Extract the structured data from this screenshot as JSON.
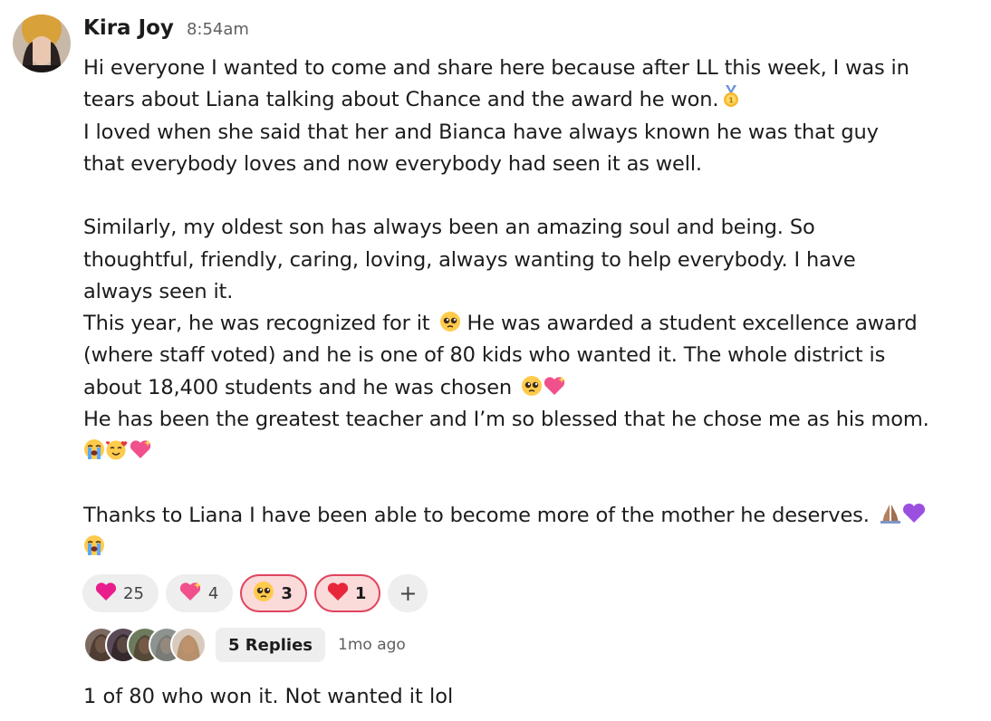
{
  "message": {
    "author": "Kira Joy",
    "time": "8:54am",
    "lines": [
      "Hi everyone I wanted to come and share here because after LL this week, I was in",
      "tears about Liana talking about Chance and the award he won.",
      "I loved when she said that her and Bianca have always known he was that guy",
      "that everybody loves and now everybody had seen it as well.",
      "",
      "Similarly, my oldest son has always been an amazing soul and being. So",
      "thoughtful, friendly, caring, loving, always wanting to help everybody. I have",
      "always seen it.",
      "This year, he was recognized for it",
      "He was awarded a student excellence award",
      "(where staff voted) and he is one of 80 kids who wanted it. The whole district is",
      "about 18,400 students and he was chosen",
      "He has been the greatest teacher and I’m so blessed that he chose me as his mom.",
      "",
      "",
      "Thanks to Liana I have been able to become more of the mother he deserves."
    ],
    "emoji": {
      "medal": "medal-emoji",
      "pleading": "pleading-face-emoji",
      "sparkling_heart": "sparkling-heart-emoji",
      "crying": "loudly-crying-face-emoji",
      "smiling_hearts": "smiling-face-with-hearts-emoji",
      "pray": "folded-hands-emoji",
      "purple_heart": "purple-heart-emoji"
    }
  },
  "reactions": [
    {
      "icon": "heart-pink-emoji",
      "count": "25",
      "active": false
    },
    {
      "icon": "sparkling-heart-emoji",
      "count": "4",
      "active": false
    },
    {
      "icon": "pleading-face-emoji",
      "count": "3",
      "active": true
    },
    {
      "icon": "red-heart-emoji",
      "count": "1",
      "active": true
    }
  ],
  "add_reaction_label": "+",
  "thread": {
    "replies_label": "5 Replies",
    "last_reply": "1mo ago"
  },
  "reply_preview": "1 of 80 who won it. Not wanted it lol",
  "colors": {
    "text": "#1d1c1d",
    "muted": "#616061",
    "pill_bg": "#eeeeee",
    "active_bg": "#fbdada",
    "active_border": "#e0445f"
  }
}
